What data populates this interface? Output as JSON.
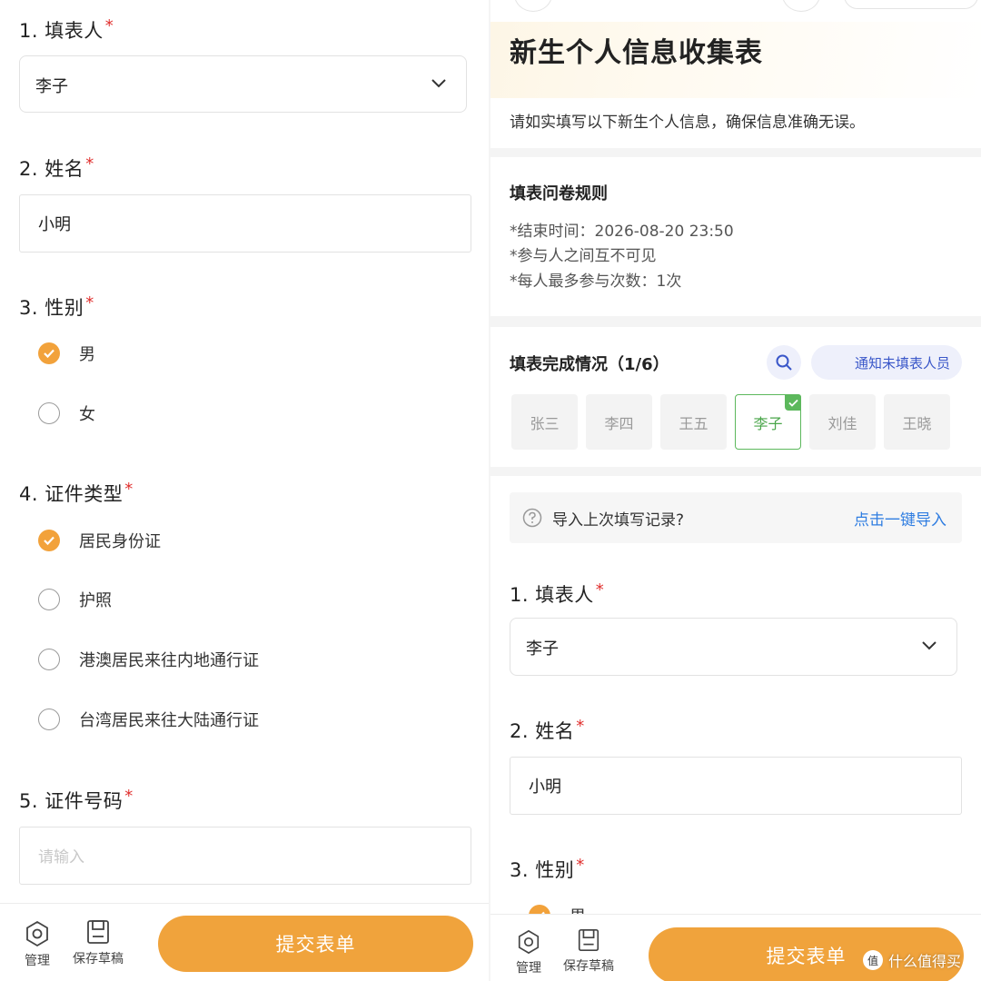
{
  "form": {
    "title": "新生个人信息收集表",
    "description": "请如实填写以下新生个人信息，确保信息准确无误。",
    "rules": {
      "heading": "填表问卷规则",
      "end_time": "*结束时间：2026-08-20 23:50",
      "visibility": "*参与人之间互不可见",
      "max_times": "*每人最多参与次数：1次"
    },
    "completion": {
      "heading": "填表完成情况（1/6）",
      "notify_label": "通知未填表人员",
      "people": [
        "张三",
        "李四",
        "王五",
        "李子",
        "刘佳",
        "王晓"
      ]
    },
    "import": {
      "question": "导入上次填写记录?",
      "action": "点击一键导入"
    },
    "required_mark": "*",
    "q1": {
      "label": "1. 填表人",
      "value": "李子"
    },
    "q2": {
      "label": "2. 姓名",
      "value": "小明"
    },
    "q3": {
      "label": "3. 性别",
      "options": [
        "男",
        "女"
      ],
      "selected": "男"
    },
    "q4": {
      "label": "4. 证件类型",
      "options": [
        "居民身份证",
        "护照",
        "港澳居民来往内地通行证",
        "台湾居民来往大陆通行证"
      ],
      "selected": "居民身份证"
    },
    "q5": {
      "label": "5. 证件号码",
      "placeholder": "请输入"
    }
  },
  "bottom_bar": {
    "manage_label": "管理",
    "draft_label": "保存草稿",
    "submit_label": "提交表单"
  },
  "watermark": "值 什么值得买",
  "colors": {
    "accent": "#f0a33c",
    "required": "#e0302e",
    "link": "#2f7de1",
    "selected_chip": "#5cb85c"
  }
}
